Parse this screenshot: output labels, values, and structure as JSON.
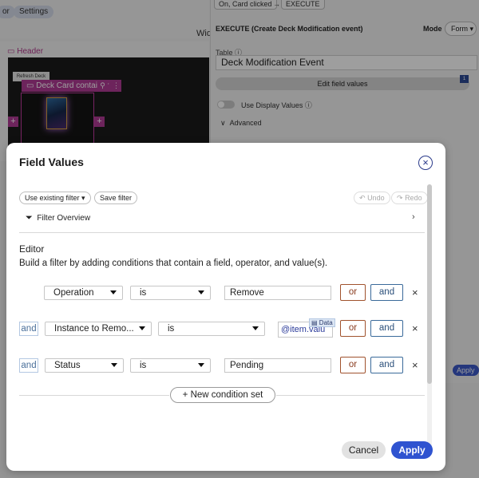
{
  "background": {
    "toolbar": {
      "tab_partial": "or",
      "settings_label": "Settings",
      "wid_text": "Wid"
    },
    "canvas": {
      "header_label": "Header",
      "refresh_deck_label": "Refresh Deck",
      "deck_container_label": "Deck Card container",
      "plus": "+"
    },
    "right_panel": {
      "breadcrumb_trigger": "On, Card clicked",
      "breadcrumb_action": "EXECUTE",
      "title": "EXECUTE (Create Deck Modification event)",
      "mode_label": "Mode",
      "mode_value": "Form",
      "table_label": "Table",
      "table_value": "Deck Modification Event",
      "edit_fields_label": "Edit field values",
      "edit_fields_badge": "1",
      "display_values_label": "Use Display Values",
      "advanced_label": "Advanced",
      "apply_label": "Apply"
    }
  },
  "modal": {
    "title": "Field Values",
    "toolbar": {
      "use_filter_label": "Use existing filter",
      "save_filter_label": "Save filter",
      "undo_label": "Undo",
      "redo_label": "Redo"
    },
    "filter_overview_label": "Filter Overview",
    "editor_heading": "Editor",
    "editor_description": "Build a filter by adding conditions that contain a field, operator, and value(s).",
    "conditions": [
      {
        "prefix": "",
        "field": "Operation",
        "operator": "is",
        "value": "Remove",
        "or_label": "or",
        "and_label": "and"
      },
      {
        "prefix": "and",
        "field": "Instance to Remo...",
        "operator": "is",
        "value": "@item.valu",
        "badge": "Data",
        "or_label": "or",
        "and_label": "and"
      },
      {
        "prefix": "and",
        "field": "Status",
        "operator": "is",
        "value": "Pending",
        "or_label": "or",
        "and_label": "and"
      }
    ],
    "new_condition_set_label": "New condition set",
    "cancel_label": "Cancel",
    "apply_label": "Apply"
  }
}
